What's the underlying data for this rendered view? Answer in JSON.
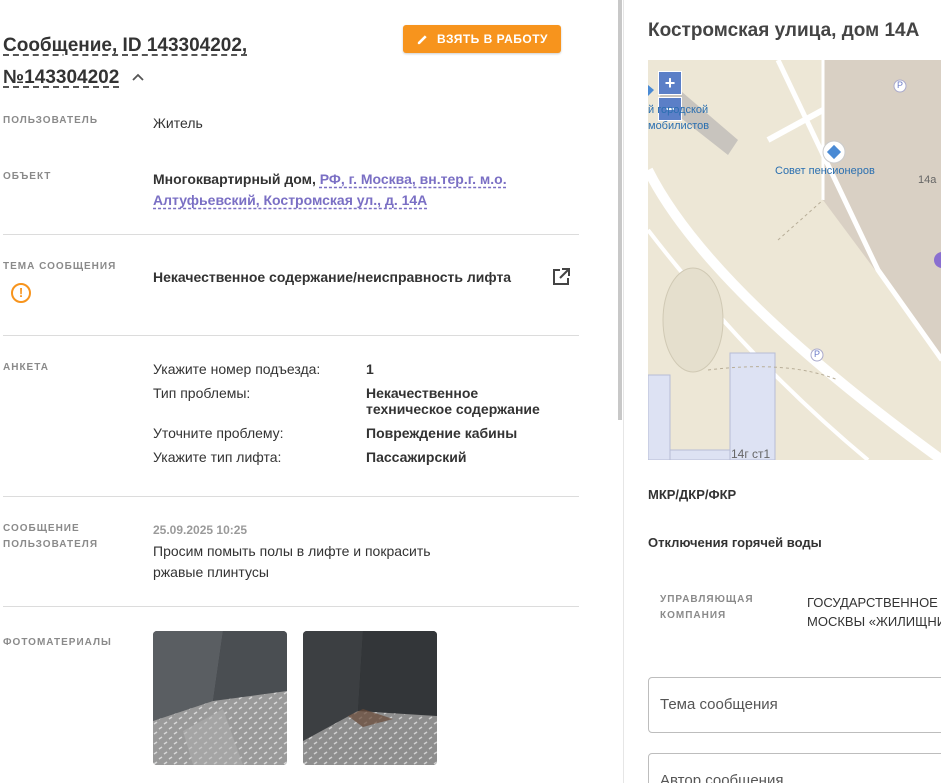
{
  "header": {
    "title_line1": "Сообщение, ID 143304202,",
    "title_line2": "№143304202",
    "take_button_label": "ВЗЯТЬ В РАБОТУ"
  },
  "fields": {
    "user_label": "ПОЛЬЗОВАТЕЛЬ",
    "user_value": "Житель",
    "object_label": "ОБЪЕКТ",
    "object_type": "Многоквартирный дом,",
    "object_address_line1": "РФ, г. Москва, вн.тер.г. м.о.",
    "object_address_line2": "Алтуфьевский, Костромская ул., д. 14А",
    "topic_label": "ТЕМА СООБЩЕНИЯ",
    "topic_value": "Некачественное содержание/неисправность лифта",
    "survey_label": "АНКЕТА",
    "message_label_line1": "СООБЩЕНИЕ",
    "message_label_line2": "ПОЛЬЗОВАТЕЛЯ",
    "message_date": "25.09.2025 10:25",
    "message_text": "Просим помыть полы в лифте и покрасить ржавые плинтусы",
    "photos_label": "ФОТОМАТЕРИАЛЫ"
  },
  "survey": [
    {
      "q": "Укажите номер подъезда:",
      "a": "1"
    },
    {
      "q": "Тип проблемы:",
      "a": "Некачественное техническое содержание"
    },
    {
      "q": "Уточните проблему:",
      "a": "Повреждение кабины"
    },
    {
      "q": "Укажите тип лифта:",
      "a": "Пассажирский"
    }
  ],
  "right": {
    "address_title": "Костромская улица, дом 14А",
    "map": {
      "zoom_in": "+",
      "zoom_out": "−",
      "poi_partial_line1": "й городской",
      "poi_partial_line2": "мобилистов",
      "poi_council": "Совет пенсионеров",
      "building_14a": "14а",
      "building_14g": "14г ст1",
      "parking": "P"
    },
    "mkr_label": "МКР/ДКР/ФКР",
    "hot_water_label": "Отключения горячей воды",
    "mgmt_label_line1": "УПРАВЛЯЮЩАЯ",
    "mgmt_label_line2": "КОМПАНИЯ",
    "mgmt_value_line1": "ГОСУДАРСТВЕННОЕ",
    "mgmt_value_line2": "МОСКВЫ «ЖИЛИЩНИ",
    "field_topic_placeholder": "Тема сообщения",
    "field_author_placeholder": "Автор сообщения"
  },
  "colors": {
    "accent_orange": "#f7941d",
    "link_purple": "#7a6fc4"
  }
}
